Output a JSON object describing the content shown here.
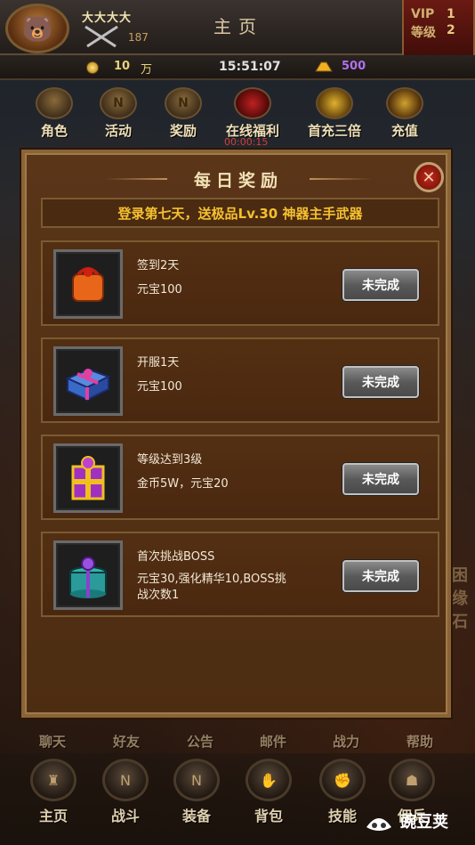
{
  "header": {
    "player_name": "大大大大",
    "power": "187",
    "title": "主页",
    "vip_label": "VIP",
    "vip_value": "1",
    "level_label": "等级",
    "level_value": "2"
  },
  "resources": {
    "coins": "10",
    "coins_unit": "万",
    "time": "15:51:07",
    "gold": "500"
  },
  "menu": {
    "items": [
      {
        "label": "角色",
        "icon": "hero-portrait-icon"
      },
      {
        "label": "活动",
        "icon": "activity-icon",
        "badge": "N"
      },
      {
        "label": "奖励",
        "icon": "reward-icon",
        "badge": "N"
      },
      {
        "label": "在线福利",
        "icon": "online-gift-icon"
      },
      {
        "label": "首充三倍",
        "icon": "gold-ingot-icon"
      },
      {
        "label": "充值",
        "icon": "treasure-chest-icon"
      }
    ],
    "timer": "00:00:15"
  },
  "dialog": {
    "title": "每日奖励",
    "banner": "登录第七天，送极品Lv.30 神器主手武器",
    "tasks": [
      {
        "title": "签到2天",
        "reward": "元宝100",
        "status": "未完成",
        "icon": "orange-gift-bag-icon",
        "icon_color": "#e8661a"
      },
      {
        "title": "开服1天",
        "reward": "元宝100",
        "status": "未完成",
        "icon": "blue-gift-box-icon",
        "icon_color": "#3a6ac8"
      },
      {
        "title": "等级达到3级",
        "reward": "金币5W，元宝20",
        "status": "未完成",
        "icon": "purple-gold-gift-icon",
        "icon_color": "#a030c0"
      },
      {
        "title": "首次挑战BOSS",
        "reward": "元宝30,强化精华10,BOSS挑战次数1",
        "status": "未完成",
        "icon": "teal-gift-box-icon",
        "icon_color": "#2a9a9a"
      }
    ]
  },
  "bottom_labels": [
    "聊天",
    "好友",
    "公告",
    "邮件",
    "战力",
    "帮助"
  ],
  "nav": [
    {
      "label": "主页",
      "icon": "castle-icon"
    },
    {
      "label": "战斗",
      "icon": "crossed-swords-icon",
      "badge": "N"
    },
    {
      "label": "装备",
      "icon": "armor-icon",
      "badge": "N"
    },
    {
      "label": "背包",
      "icon": "bag-icon"
    },
    {
      "label": "技能",
      "icon": "fist-icon"
    },
    {
      "label": "佣兵",
      "icon": "mercenary-icon"
    }
  ],
  "side_text": [
    "困",
    "缘",
    "石"
  ],
  "watermark": "豌豆荚"
}
